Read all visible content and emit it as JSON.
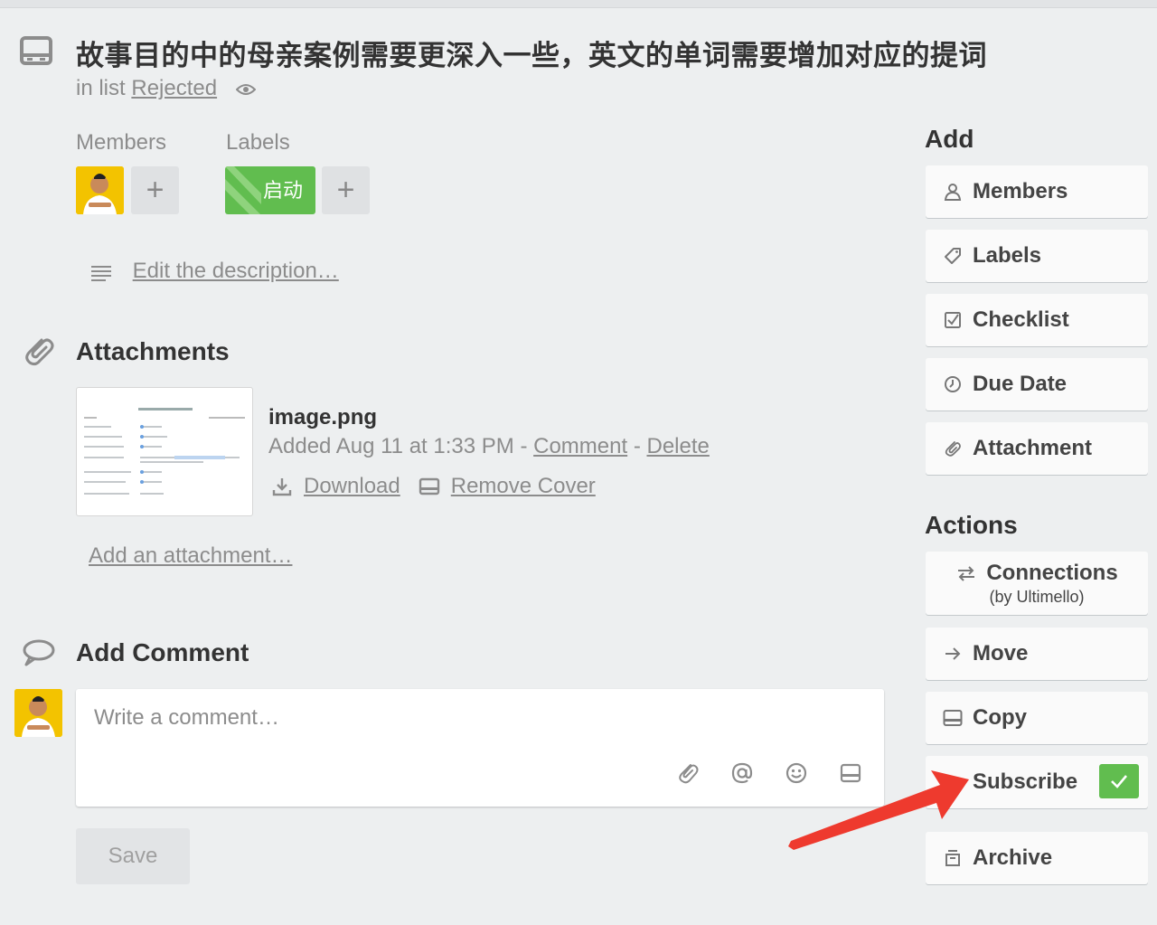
{
  "card": {
    "title": "故事目的中的母亲案例需要更深入一些，英文的单词需要增加对应的提词",
    "in_list_prefix": "in list",
    "list_name": "Rejected"
  },
  "members": {
    "heading": "Members"
  },
  "labels": {
    "heading": "Labels",
    "items": [
      {
        "text": "启动",
        "color": "#61bd4f"
      }
    ]
  },
  "description": {
    "link": "Edit the description…"
  },
  "attachments": {
    "heading": "Attachments",
    "items": [
      {
        "name": "image.png",
        "added": "Added Aug 11 at 1:33 PM",
        "sep": "-",
        "comment": "Comment",
        "delete": "Delete",
        "download": "Download",
        "remove_cover": "Remove Cover"
      }
    ],
    "add_link": "Add an attachment…"
  },
  "comment": {
    "heading": "Add Comment",
    "placeholder": "Write a comment…",
    "save": "Save"
  },
  "sidebar": {
    "add_heading": "Add",
    "add": [
      {
        "label": "Members",
        "icon": "person-icon"
      },
      {
        "label": "Labels",
        "icon": "tag-icon"
      },
      {
        "label": "Checklist",
        "icon": "checkbox-icon"
      },
      {
        "label": "Due Date",
        "icon": "clock-icon"
      },
      {
        "label": "Attachment",
        "icon": "paperclip-icon"
      }
    ],
    "actions_heading": "Actions",
    "actions": [
      {
        "label": "Connections",
        "sub": "(by Ultimello)",
        "icon": "swap-arrows-icon"
      },
      {
        "label": "Move",
        "icon": "arrow-right-icon"
      },
      {
        "label": "Copy",
        "icon": "card-icon"
      },
      {
        "label": "Subscribe",
        "icon": "eye-icon",
        "checked": true
      },
      {
        "label": "Archive",
        "icon": "archive-icon"
      }
    ]
  },
  "colors": {
    "accent_green": "#61bd4f",
    "annotation_red": "#ee3a2e"
  }
}
